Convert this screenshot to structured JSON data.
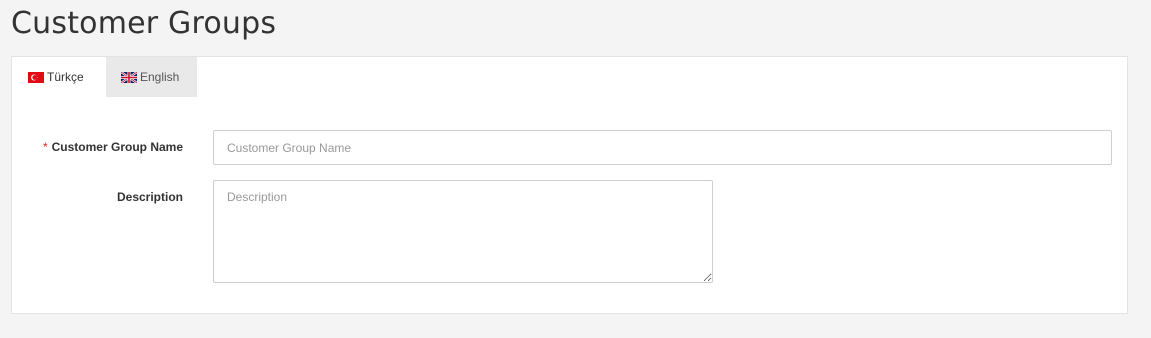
{
  "page": {
    "title": "Customer Groups"
  },
  "tabs": [
    {
      "label": "Türkçe",
      "flag": "turkey-flag-icon",
      "active": true
    },
    {
      "label": "English",
      "flag": "uk-flag-icon",
      "active": false
    }
  ],
  "form": {
    "name": {
      "required_mark": "*",
      "label": "Customer Group Name",
      "value": "",
      "placeholder": "Customer Group Name"
    },
    "description": {
      "label": "Description",
      "value": "",
      "placeholder": "Description"
    }
  },
  "colors": {
    "required": "#e02020",
    "flag_tr": "#e30a17"
  }
}
